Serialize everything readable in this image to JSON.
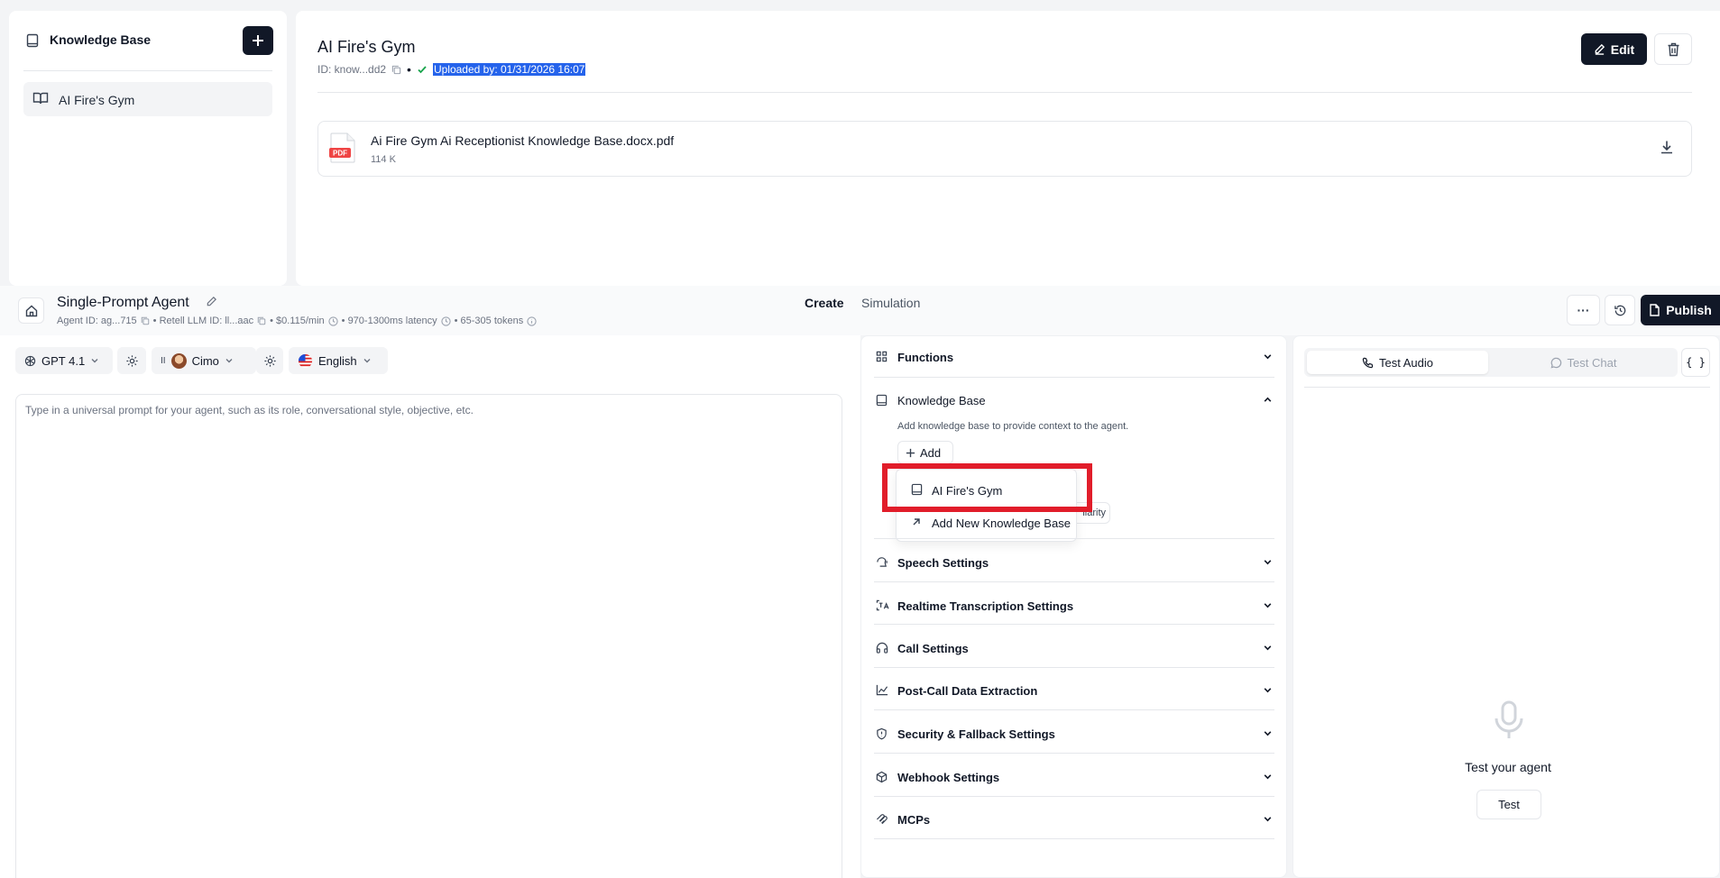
{
  "kb_sidebar": {
    "title": "Knowledge Base",
    "items": [
      {
        "label": "AI Fire's Gym"
      }
    ]
  },
  "kb_detail": {
    "title": "AI Fire's Gym",
    "id_label": "ID: know...dd2",
    "uploaded_label": "Uploaded by: 01/31/2026 16:07",
    "edit_label": "Edit",
    "file": {
      "name": "Ai Fire Gym Ai Receptionist Knowledge Base.docx.pdf",
      "size": "114 K",
      "type_badge": "PDF"
    }
  },
  "agent_header": {
    "name": "Single-Prompt Agent",
    "agent_id": "Agent ID: ag...715",
    "llm_id": "• Retell LLM ID: ll...aac",
    "price": "• $0.115/min",
    "latency": "• 970-1300ms latency",
    "tokens": "• 65-305 tokens",
    "tabs": [
      "Create",
      "Simulation"
    ],
    "publish_label": "Publish",
    "more_label": "···"
  },
  "prompt_toolbar": {
    "model": "GPT 4.1",
    "voice": "Cimo",
    "voice_prefix": "II",
    "language": "English"
  },
  "prompt": {
    "placeholder": "Type in a universal prompt for your agent, such as its role, conversational style, objective, etc."
  },
  "settings": {
    "functions": "Functions",
    "knowledge_base": {
      "label": "Knowledge Base",
      "description": "Add knowledge base to provide context to the agent.",
      "add_label": "Add",
      "hidden_chip": "ilarity",
      "dropdown": [
        "AI Fire's Gym",
        "Add New Knowledge Base"
      ]
    },
    "sections": [
      "Speech Settings",
      "Realtime Transcription Settings",
      "Call Settings",
      "Post-Call Data Extraction",
      "Security & Fallback Settings",
      "Webhook Settings",
      "MCPs"
    ]
  },
  "test_panel": {
    "tab_audio": "Test Audio",
    "tab_chat": "Test Chat",
    "code_label": "{ }",
    "prompt_label": "Test your agent",
    "test_button": "Test"
  },
  "colors": {
    "highlight": "#e11d2a",
    "selection": "#2563eb",
    "dark": "#111827",
    "pdf": "#ef4444"
  }
}
